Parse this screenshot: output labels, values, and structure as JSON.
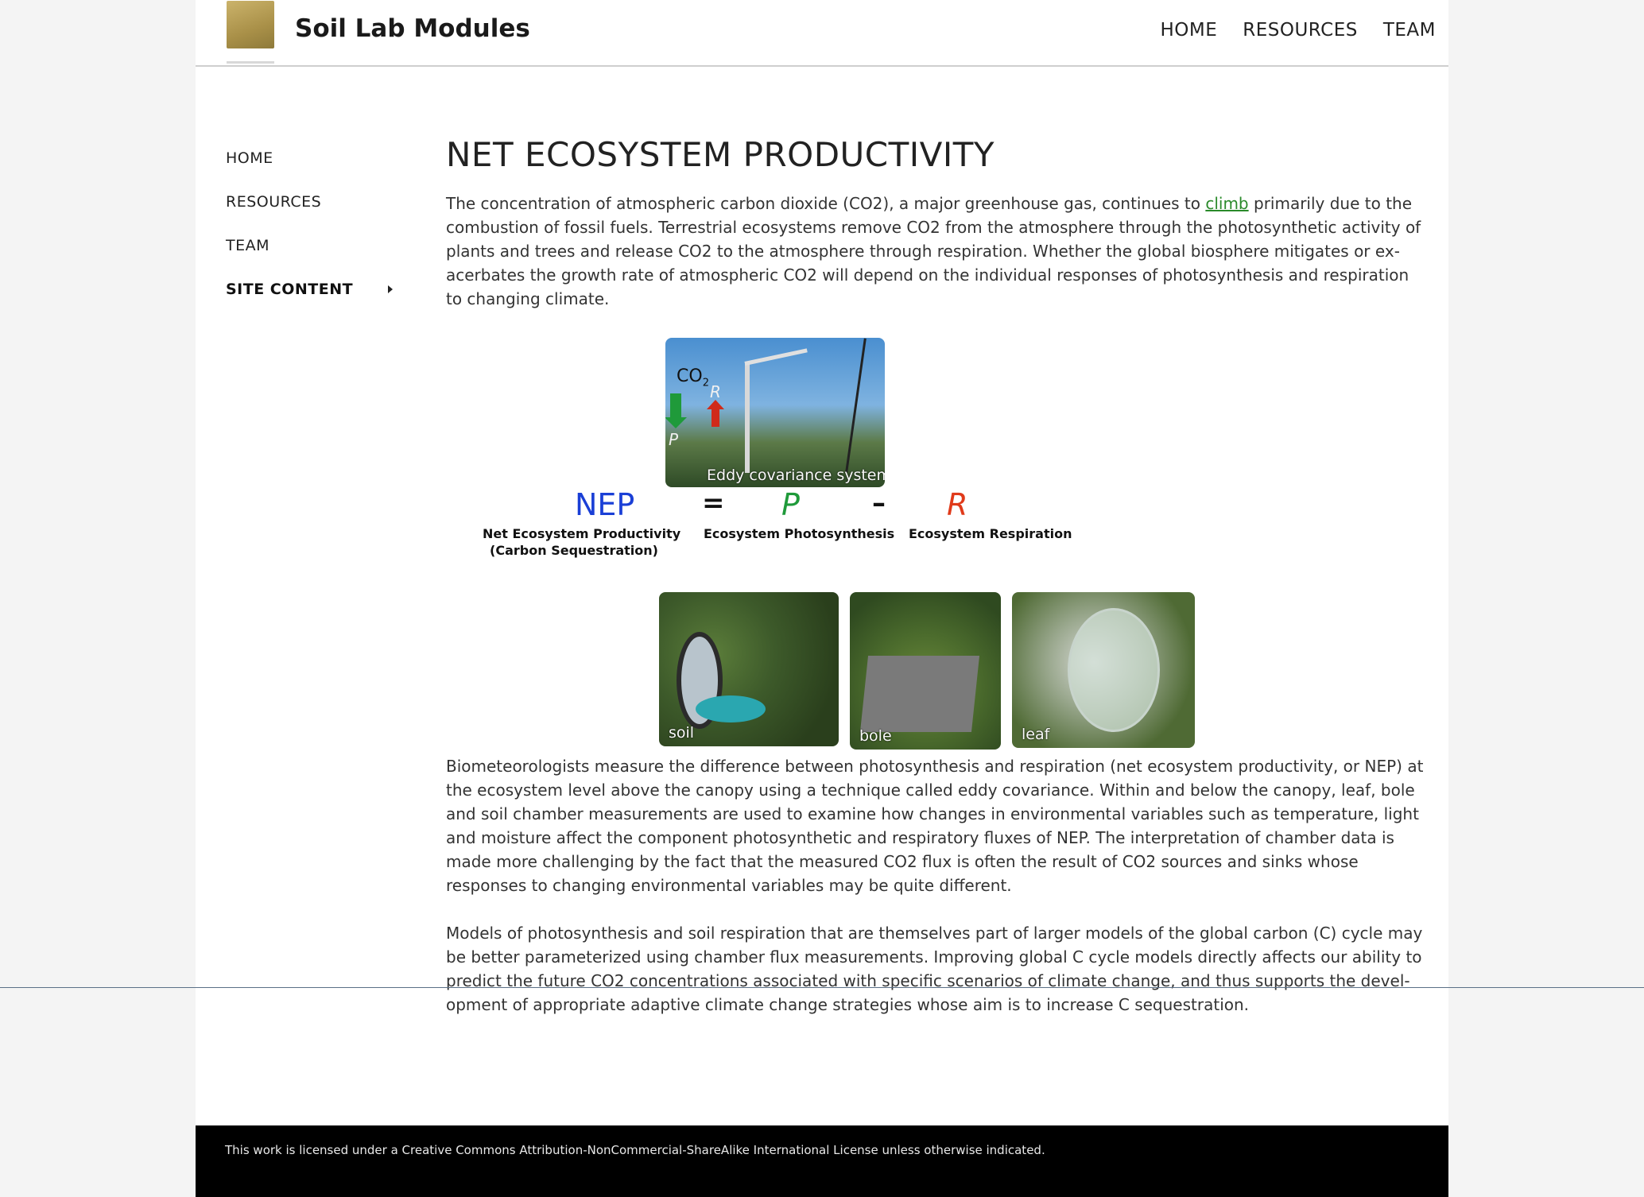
{
  "header": {
    "logo_icon": "soil-lab-logo",
    "site_title": "Soil Lab Modules",
    "nav": [
      {
        "label": "HOME"
      },
      {
        "label": "RESOURCES"
      },
      {
        "label": "TEAM"
      }
    ]
  },
  "sidebar": {
    "items": [
      {
        "label": "HOME"
      },
      {
        "label": "RESOURCES"
      },
      {
        "label": "TEAM"
      },
      {
        "label": "SITE CONTENT"
      }
    ]
  },
  "main": {
    "title": "NET ECOSYSTEM PRODUCTIVITY",
    "intro_before_link": "The concentration of atmospheric carbon dioxide (CO2), a major greenhouse gas, continues to ",
    "intro_link": "climb",
    "intro_after_link": " primarily due to the combustion of fossil fuels. Terrestrial ecosystems remove CO2 from the atmosphere through the photosynthetic activity of plants and trees and release CO2 to the atmosphere through respiration. Whether the global biosphere mitigates or ex­acerbates the growth rate of atmospheric CO2 will depend on the individual responses of photosynthesis and respiration to changing climate.",
    "figure": {
      "co2_label": "CO",
      "co2_sub": "2",
      "arrow_p_label": "P",
      "arrow_r_label": "R",
      "photo_caption": "Eddy covariance system",
      "eq_nep": "NEP",
      "eq_equals": "=",
      "eq_p": "P",
      "eq_minus": "–",
      "eq_r": "R",
      "label_nep_line1": "Net Ecosystem Productivity",
      "label_nep_line2": "(Carbon Sequestration)",
      "label_photo": "Ecosystem Photosynthesis",
      "label_resp": "Ecosystem Respiration",
      "thumb_soil": "soil",
      "thumb_bole": "bole",
      "thumb_leaf": "leaf"
    },
    "para2": "Biometeorologists measure the difference between photosynthesis and respiration (net ecosystem productivity, or NEP) at the ecosystem level above the canopy using a technique called eddy covariance. Within and below the canopy, leaf, bole and soil chamber measurements are used to examine how changes in environmental variables such as temperature, light and moisture affect the component photosynthetic and respiratory fluxes of NEP. The interpretation of chamber data is made more challenging by the fact that the measured CO2 flux is often the result of CO2 sources and sinks whose responses to changing environmental variables may be quite different.",
    "para3": "Models of photosynthesis and soil respiration that are themselves part of larger models of the global carbon (C) cycle may be better parameterized using chamber flux measurements. Improving global C cycle models directly affects our ability to predict the future CO2 concentrations associated with specific scenarios of climate change, and thus supports the devel­opment of appropriate adaptive climate change strategies whose aim is to increase C sequestration."
  },
  "footer": {
    "license_text": "This work is licensed under a Creative Commons Attribution-NonCommercial-ShareAlike International License unless otherwise indicated."
  },
  "colors": {
    "link_green": "#2a8a2a",
    "nep_blue": "#1a3fd6",
    "photosynthesis_green": "#1f9a3a",
    "respiration_red": "#e03a1a",
    "footer_bg": "#000000"
  }
}
